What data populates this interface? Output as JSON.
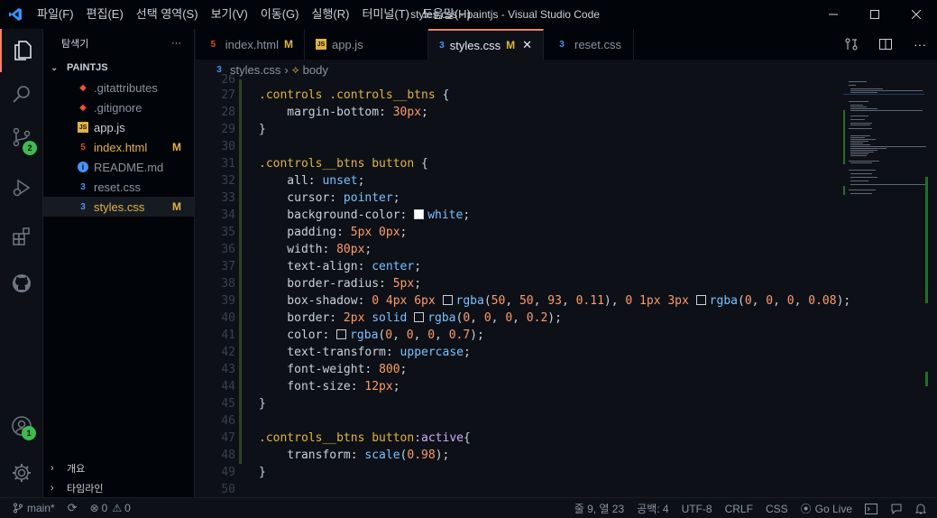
{
  "titlebar": {
    "menu": [
      {
        "label": "파일(F)"
      },
      {
        "label": "편집(E)"
      },
      {
        "label": "선택 영역(S)"
      },
      {
        "label": "보기(V)"
      },
      {
        "label": "이동(G)"
      },
      {
        "label": "실행(R)"
      },
      {
        "label": "터미널(T)"
      },
      {
        "label": "도움말(H)"
      }
    ],
    "title": "styles.css - paintjs - Visual Studio Code"
  },
  "activity": {
    "source_control_badge": "2",
    "accounts_badge": "1"
  },
  "sidebar": {
    "header": "탐색기",
    "more": "···",
    "folder": "PAINTJS",
    "files": [
      {
        "name": ".gitattributes",
        "icon": "git-icon",
        "status": ""
      },
      {
        "name": ".gitignore",
        "icon": "git-icon",
        "status": ""
      },
      {
        "name": "app.js",
        "icon": "js-icon",
        "status": ""
      },
      {
        "name": "index.html",
        "icon": "html-icon",
        "status": "M"
      },
      {
        "name": "README.md",
        "icon": "info-icon",
        "status": ""
      },
      {
        "name": "reset.css",
        "icon": "css-icon",
        "status": ""
      },
      {
        "name": "styles.css",
        "icon": "css-icon",
        "status": "M"
      }
    ],
    "outline": "개요",
    "timeline": "타임라인"
  },
  "tabs": [
    {
      "label": "index.html",
      "mod": "M",
      "icon": "html-icon"
    },
    {
      "label": "app.js",
      "mod": "",
      "icon": "js-icon"
    },
    {
      "label": "styles.css",
      "mod": "M",
      "icon": "css-icon",
      "active": true
    },
    {
      "label": "reset.css",
      "mod": "",
      "icon": "css-icon"
    }
  ],
  "breadcrumb": {
    "file": "styles.css",
    "symbol": "body"
  },
  "editor": {
    "line_numbers": [
      "26",
      "27",
      "28",
      "29",
      "30",
      "31",
      "32",
      "33",
      "34",
      "35",
      "36",
      "37",
      "38",
      "39",
      "40",
      "41",
      "42",
      "43",
      "44",
      "45",
      "46",
      "47",
      "48",
      "49",
      "50"
    ]
  },
  "statusbar": {
    "branch": "main*",
    "errors": "0",
    "warnings": "0",
    "position": "줄 9, 열 23",
    "spaces": "공백: 4",
    "encoding": "UTF-8",
    "eol": "CRLF",
    "language": "CSS",
    "golive": "Go Live"
  },
  "colors": {
    "accent": "#f78166",
    "selector": "#e3b341",
    "number": "#ff9a6a",
    "value": "#79c0ff",
    "modified": "#e3b341",
    "badge": "#3fb950"
  }
}
